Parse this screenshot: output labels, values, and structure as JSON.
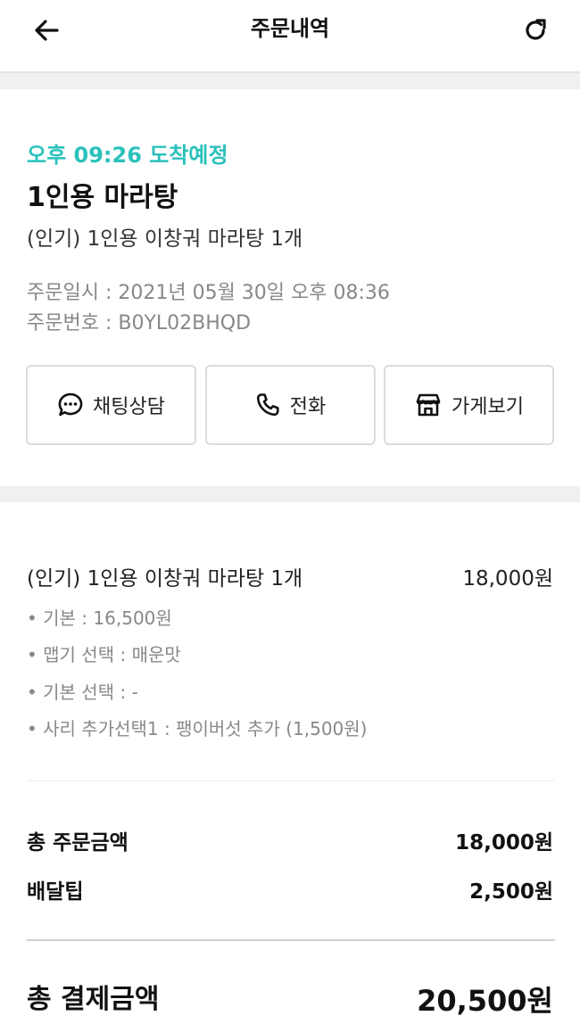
{
  "header": {
    "title": "주문내역",
    "back_icon": "arrow-left-icon",
    "refresh_icon": "refresh-icon"
  },
  "order": {
    "eta": "오후 09:26 도착예정",
    "store_name": "1인용 마라탕",
    "summary": "(인기) 1인용 이창궈 마라탕 1개",
    "date_line": "주문일시 : 2021년 05월 30일 오후 08:36",
    "number_line": "주문번호 : B0YL02BHQD",
    "accent_color": "#2ac1bc"
  },
  "actions": {
    "chat": {
      "label": "채팅상담",
      "icon": "chat-bubble-icon"
    },
    "call": {
      "label": "전화",
      "icon": "phone-icon"
    },
    "store": {
      "label": "가게보기",
      "icon": "store-icon"
    }
  },
  "item": {
    "name": "(인기) 1인용 이창궈 마라탕 1개",
    "price": "18,000원",
    "options": [
      "• 기본 : 16,500원",
      "• 맵기 선택 : 매운맛",
      "• 기본 선택 : -",
      "• 사리 추가선택1 : 팽이버섯 추가 (1,500원)"
    ]
  },
  "summary": {
    "order_total_label": "총 주문금액",
    "order_total_value": "18,000원",
    "delivery_tip_label": "배달팁",
    "delivery_tip_value": "2,500원",
    "payment_total_label": "총 결제금액",
    "payment_total_value": "20,500원"
  }
}
